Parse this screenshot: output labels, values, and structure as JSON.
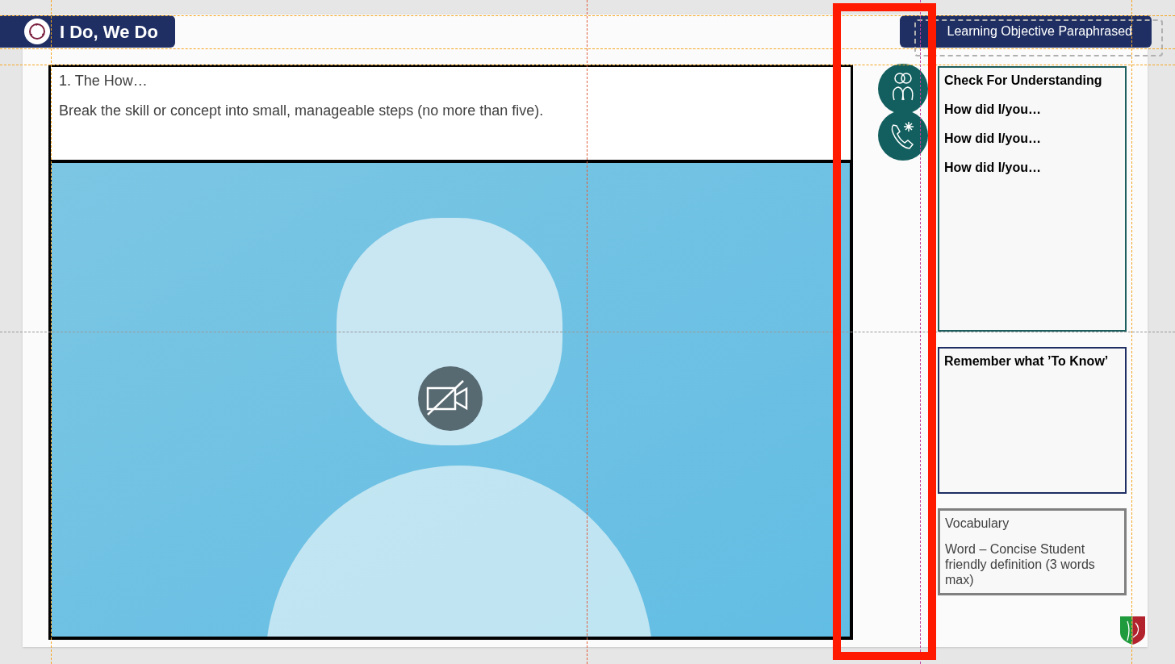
{
  "slide_title": "I Do, We Do",
  "objective": "Learning Objective Paraphrased",
  "step": {
    "heading": "1. The How…",
    "text": "Break the skill or concept into small, manageable steps (no more than five)."
  },
  "check": {
    "title": "Check For Understanding",
    "prompts": [
      "How did I/you…",
      "How did I/you…",
      "How did I/you…"
    ]
  },
  "remember": {
    "title": "Remember what ’To Know’"
  },
  "vocabulary": {
    "title": "Vocabulary",
    "definition": "Word – Concise Student friendly definition (3 words max)"
  }
}
